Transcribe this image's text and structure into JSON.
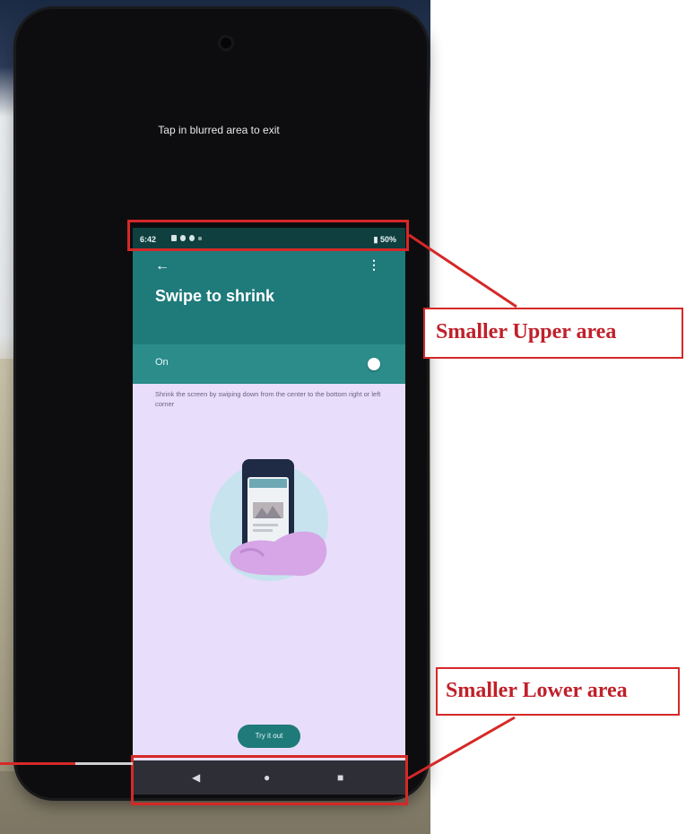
{
  "overlay": {
    "exit_hint": "Tap in blurred area to exit"
  },
  "status_bar": {
    "time": "6:42",
    "battery": "50%"
  },
  "screen": {
    "title": "Swipe to shrink",
    "toggle_label": "On",
    "toggle_state": true,
    "description": "Shrink the screen by swiping down from the center to the bottom right or left corner",
    "button_label": "Try it out"
  },
  "annotations": {
    "upper_label": "Smaller Upper area",
    "lower_label": "Smaller Lower area"
  },
  "nav": {
    "back_icon": "back-triangle",
    "home_icon": "home-circle",
    "recents_icon": "recents-square"
  },
  "colors": {
    "header": "#1f7a7a",
    "toggle_row": "#2b8c8a",
    "highlight": "#d62828",
    "screen_bg": "#e8defb"
  }
}
